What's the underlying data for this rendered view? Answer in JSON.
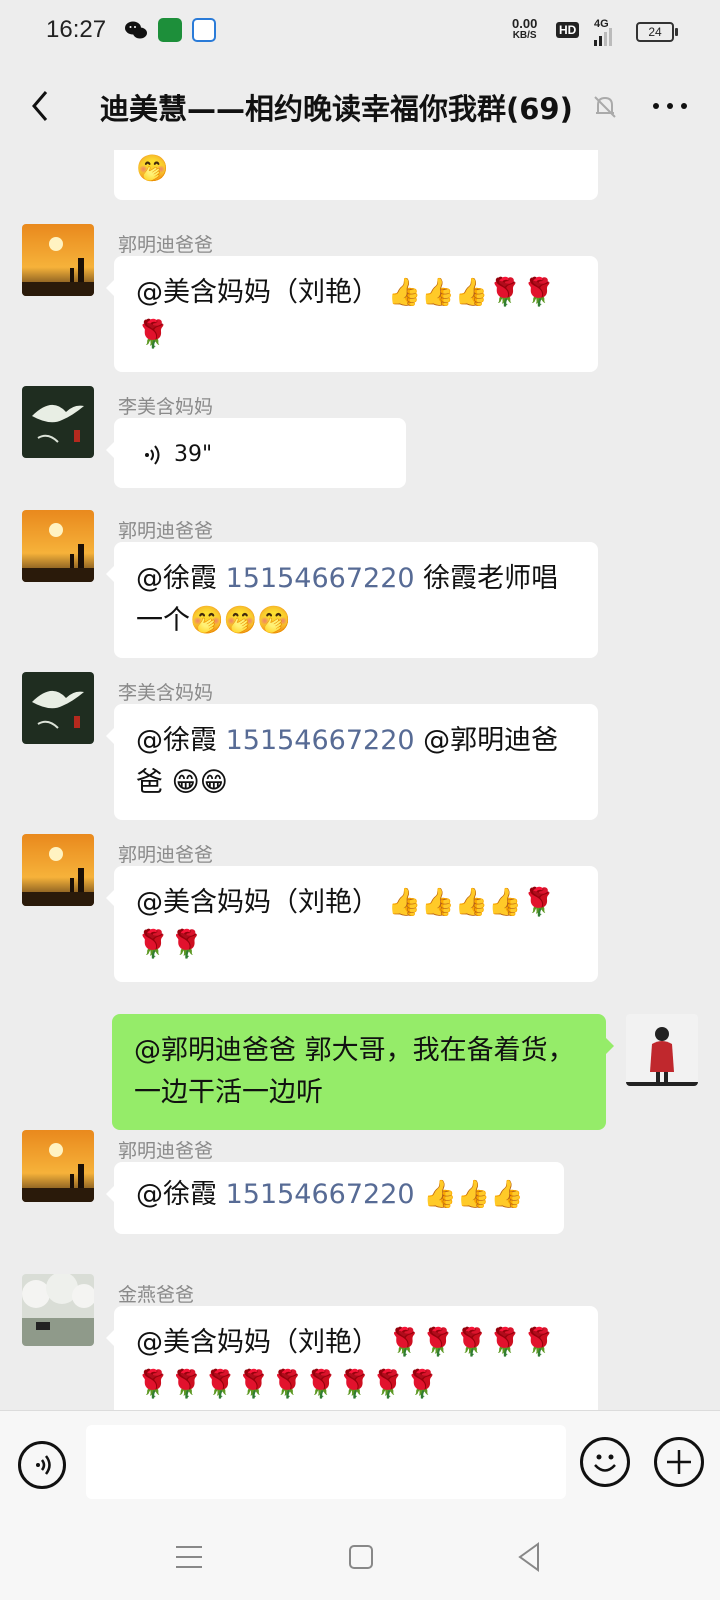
{
  "status_bar": {
    "time": "16:27",
    "speed_value": "0.00",
    "speed_unit": "KB/S",
    "hd": "HD",
    "network": "4G",
    "battery": "24"
  },
  "header": {
    "title": "迪美慧——相约晚读幸福你我群(69)"
  },
  "messages": [
    {
      "text": "🤭"
    },
    {
      "sender": "郭明迪爸爸",
      "text": "@美含妈妈（刘艳） 👍👍👍🌹🌹🌹"
    },
    {
      "sender": "李美含妈妈",
      "duration": "39\""
    },
    {
      "sender": "郭明迪爸爸",
      "prefix": "@徐霞 ",
      "phone": "15154667220",
      "suffix": " 徐霞老师唱一个🤭🤭🤭"
    },
    {
      "sender": "李美含妈妈",
      "prefix": "@徐霞 ",
      "phone": "15154667220",
      "suffix": " @郭明迪爸爸 😁😁"
    },
    {
      "sender": "郭明迪爸爸",
      "text": "@美含妈妈（刘艳） 👍👍👍👍🌹🌹🌹"
    },
    {
      "text": "@郭明迪爸爸  郭大哥，我在备着货，一边干活一边听"
    },
    {
      "sender": "郭明迪爸爸",
      "prefix": "@徐霞 ",
      "phone": "15154667220",
      "suffix": " 👍👍👍"
    },
    {
      "sender": "金燕爸爸",
      "text": "@美含妈妈（刘艳） 🌹🌹🌹🌹🌹🌹🌹🌹🌹🌹🌹🌹🌹🌹"
    }
  ],
  "colors": {
    "my_bubble": "#95ec69",
    "link": "#576b95",
    "background": "#ededed"
  }
}
